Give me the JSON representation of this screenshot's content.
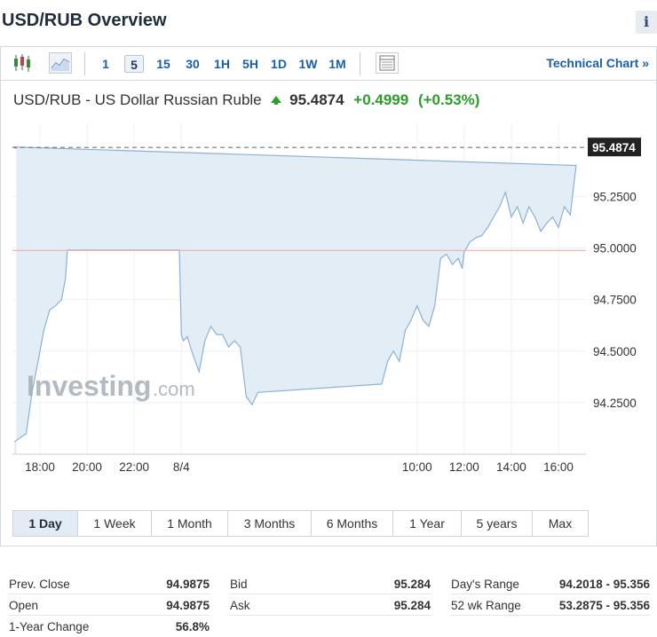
{
  "page": {
    "title": "USD/RUB Overview",
    "info_glyph": "i"
  },
  "toolbar": {
    "intervals": [
      "1",
      "5",
      "15",
      "30",
      "1H",
      "5H",
      "1D",
      "1W",
      "1M"
    ],
    "active_interval": "5",
    "technical_chart_label": "Technical Chart »",
    "icons": [
      "candlestick-icon",
      "area-chart-icon",
      "table-view-icon"
    ]
  },
  "quote": {
    "name": "USD/RUB - US Dollar Russian Ruble",
    "last": "95.4874",
    "change": "+0.4999",
    "change_pct": "(+0.53%)",
    "direction_icon": "up-arrow-icon",
    "up_color": "#2a9d2a"
  },
  "watermark": {
    "brand": "Investing",
    "suffix": ".com"
  },
  "chart_data": {
    "type": "area",
    "x_ticks": [
      "18:00",
      "20:00",
      "22:00",
      "8/4",
      "10:00",
      "12:00",
      "14:00",
      "16:00"
    ],
    "y_ticks": [
      "94.2500",
      "94.5000",
      "94.7500",
      "95.0000",
      "95.2500"
    ],
    "ylim": [
      94.0,
      95.6
    ],
    "last_price_label": "95.4874",
    "prev_close": 94.9875,
    "series_color": "#8bb1d4",
    "fill_color": "#e3edf6",
    "prev_close_color": "#f0b4b4",
    "series": [
      {
        "x": [
          "16:55",
          "17:10",
          "17:25",
          "17:40",
          "17:55",
          "18:10",
          "18:25",
          "18:40",
          "18:55",
          "19:05",
          "19:10",
          "23:55",
          "00:00",
          "00:05",
          "00:15",
          "00:30",
          "00:45",
          "01:00",
          "01:15",
          "01:30",
          "01:45",
          "02:00",
          "02:15",
          "02:30",
          "02:45",
          "03:00",
          "03:15",
          "08:30",
          "08:45",
          "09:00",
          "09:15",
          "09:30",
          "09:45",
          "10:00",
          "10:15",
          "10:30",
          "10:45",
          "11:00",
          "11:15",
          "11:30",
          "11:45",
          "11:55",
          "12:00",
          "12:15",
          "12:30",
          "12:45",
          "13:00",
          "13:15",
          "13:30",
          "13:45",
          "14:00",
          "14:15",
          "14:30",
          "14:45",
          "15:00",
          "15:15",
          "15:30",
          "15:45",
          "16:00",
          "16:15",
          "16:30",
          "16:45",
          "16:55",
          "17:00"
        ],
        "y": [
          94.06,
          94.08,
          94.1,
          94.3,
          94.45,
          94.6,
          94.7,
          94.72,
          94.75,
          94.85,
          94.99,
          94.99,
          94.58,
          94.55,
          94.57,
          94.48,
          94.4,
          94.55,
          94.62,
          94.58,
          94.58,
          94.52,
          94.55,
          94.52,
          94.28,
          94.24,
          94.3,
          94.34,
          94.45,
          94.5,
          94.45,
          94.6,
          94.65,
          94.72,
          94.65,
          94.62,
          94.72,
          94.95,
          94.97,
          94.92,
          94.95,
          94.9,
          94.98,
          95.03,
          95.05,
          95.06,
          95.1,
          95.15,
          95.2,
          95.27,
          95.15,
          95.2,
          95.12,
          95.2,
          95.15,
          95.08,
          95.12,
          95.15,
          95.1,
          95.2,
          95.16,
          95.4,
          95.49,
          95.48
        ]
      }
    ],
    "x_range_hours": [
      "16:50",
      "17:10"
    ]
  },
  "ranges": {
    "items": [
      "1 Day",
      "1 Week",
      "1 Month",
      "3 Months",
      "6 Months",
      "1 Year",
      "5 years",
      "Max"
    ],
    "active": "1 Day"
  },
  "stats": {
    "prev_close": {
      "label": "Prev. Close",
      "value": "94.9875"
    },
    "open": {
      "label": "Open",
      "value": "94.9875"
    },
    "year_change": {
      "label": "1-Year Change",
      "value": "56.8%"
    },
    "bid": {
      "label": "Bid",
      "value": "95.284"
    },
    "ask": {
      "label": "Ask",
      "value": "95.284"
    },
    "days_range": {
      "label": "Day's Range",
      "value": "94.2018 - 95.356"
    },
    "wk52_range": {
      "label": "52 wk Range",
      "value": "53.2875 - 95.356"
    }
  }
}
